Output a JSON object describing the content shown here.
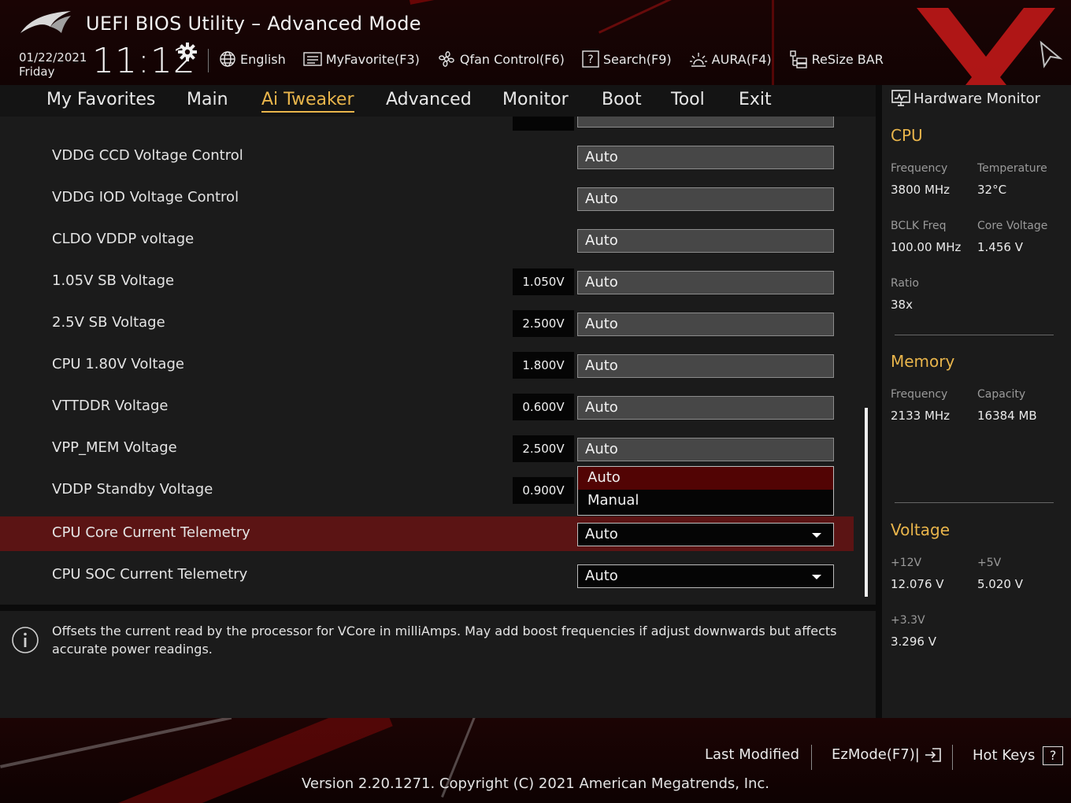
{
  "header": {
    "title": "UEFI BIOS Utility – Advanced Mode",
    "date": "01/22/2021",
    "day": "Friday",
    "time": "11:12",
    "toolbar": [
      {
        "label": "English",
        "icon": "globe-icon"
      },
      {
        "label": "MyFavorite(F3)",
        "icon": "favorite-list-icon"
      },
      {
        "label": "Qfan Control(F6)",
        "icon": "fan-icon"
      },
      {
        "label": "Search(F9)",
        "icon": "search-help-icon"
      },
      {
        "label": "AURA(F4)",
        "icon": "aura-light-icon"
      },
      {
        "label": "ReSize BAR",
        "icon": "resize-bar-icon"
      }
    ]
  },
  "nav": {
    "tabs": [
      "My Favorites",
      "Main",
      "Ai Tweaker",
      "Advanced",
      "Monitor",
      "Boot",
      "Tool",
      "Exit"
    ],
    "active": "Ai Tweaker"
  },
  "settings": [
    {
      "label": "VDDG CCD Voltage Control",
      "value": "",
      "field": "Auto"
    },
    {
      "label": "VDDG IOD Voltage Control",
      "value": "",
      "field": "Auto"
    },
    {
      "label": "CLDO VDDP voltage",
      "value": "",
      "field": "Auto"
    },
    {
      "label": "1.05V SB Voltage",
      "value": "1.050V",
      "field": "Auto"
    },
    {
      "label": "2.5V SB Voltage",
      "value": "2.500V",
      "field": "Auto"
    },
    {
      "label": "CPU 1.80V Voltage",
      "value": "1.800V",
      "field": "Auto"
    },
    {
      "label": "VTTDDR Voltage",
      "value": "0.600V",
      "field": "Auto"
    },
    {
      "label": "VPP_MEM Voltage",
      "value": "2.500V",
      "field": "Auto"
    },
    {
      "label": "VDDP Standby Voltage",
      "value": "0.900V",
      "field": ""
    },
    {
      "label": "CPU Core Current Telemetry",
      "value": "",
      "field": "Auto"
    },
    {
      "label": "CPU SOC Current Telemetry",
      "value": "",
      "field": "Auto"
    }
  ],
  "dropdown": {
    "options": [
      "Auto",
      "Manual"
    ],
    "highlighted": "Auto"
  },
  "help": {
    "text": "Offsets the current read by the processor for VCore in milliAmps. May add boost frequencies if adjust downwards but affects accurate power readings."
  },
  "hw_monitor": {
    "title": "Hardware Monitor",
    "cpu": {
      "title": "CPU",
      "frequency_label": "Frequency",
      "frequency": "3800 MHz",
      "temperature_label": "Temperature",
      "temperature": "32°C",
      "bclk_label": "BCLK Freq",
      "bclk": "100.00 MHz",
      "core_voltage_label": "Core Voltage",
      "core_voltage": "1.456 V",
      "ratio_label": "Ratio",
      "ratio": "38x"
    },
    "memory": {
      "title": "Memory",
      "frequency_label": "Frequency",
      "frequency": "2133 MHz",
      "capacity_label": "Capacity",
      "capacity": "16384 MB"
    },
    "voltage": {
      "title": "Voltage",
      "v12_label": "+12V",
      "v12": "12.076 V",
      "v5_label": "+5V",
      "v5": "5.020 V",
      "v33_label": "+3.3V",
      "v33": "3.296 V"
    }
  },
  "footer": {
    "last_modified": "Last Modified",
    "ezmode": "EzMode(F7)|",
    "hot_keys": "Hot Keys",
    "hot_keys_box": "?",
    "version": "Version 2.20.1271. Copyright (C) 2021 American Megatrends, Inc."
  },
  "colors": {
    "accent": "#e9b54b",
    "selected_row": "#5b1414",
    "dropdown_highlight": "#520404"
  }
}
